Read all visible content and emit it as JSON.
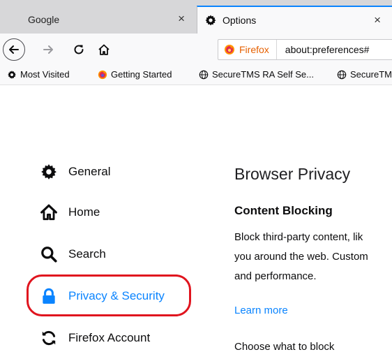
{
  "tabs": [
    {
      "title": "Google",
      "close": "×",
      "active": false
    },
    {
      "title": "Options",
      "close": "×",
      "active": true,
      "icon": "gear-icon"
    }
  ],
  "navbar": {
    "back_icon": "back-arrow-icon",
    "forward_icon": "forward-arrow-icon",
    "reload_icon": "reload-icon",
    "home_icon": "home-icon",
    "identity_label": "Firefox",
    "address": "about:preferences#"
  },
  "bookmarks": [
    {
      "label": "Most Visited",
      "icon": "gear-icon"
    },
    {
      "label": "Getting Started",
      "icon": "firefox-icon"
    },
    {
      "label": "SecureTMS RA Self Se...",
      "icon": "globe-icon"
    },
    {
      "label": "SecureTM",
      "icon": "globe-icon"
    }
  ],
  "sidebar": {
    "items": [
      {
        "label": "General",
        "icon": "gear-icon"
      },
      {
        "label": "Home",
        "icon": "home-icon"
      },
      {
        "label": "Search",
        "icon": "search-icon"
      },
      {
        "label": "Privacy & Security",
        "icon": "lock-icon",
        "selected": true
      },
      {
        "label": "Firefox Account",
        "icon": "sync-icon"
      }
    ]
  },
  "main": {
    "heading": "Browser Privacy",
    "section_title": "Content Blocking",
    "description_lines": [
      "Block third-party content, lik",
      "you around the web. Custom",
      "and performance."
    ],
    "learn_more": "Learn more",
    "choose": "Choose what to block"
  },
  "colors": {
    "accent": "#0a84ff",
    "highlight": "#e0141e",
    "tabstrip": "#d7d7d9",
    "toolbar": "#f9f9fa",
    "firefox_orange": "#e66000"
  }
}
